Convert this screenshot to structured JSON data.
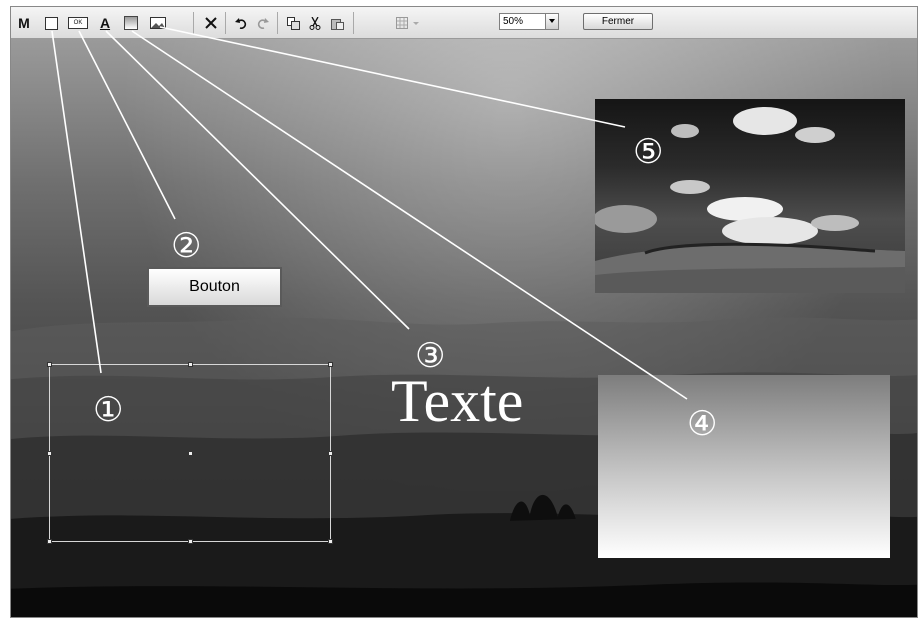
{
  "toolbar": {
    "tools": [
      {
        "name": "text-tool",
        "glyph": "M"
      },
      {
        "name": "frame-tool",
        "glyph": ""
      },
      {
        "name": "button-tool",
        "glyph": "OK"
      },
      {
        "name": "font-tool",
        "glyph": "A"
      },
      {
        "name": "gradient-tool",
        "glyph": ""
      },
      {
        "name": "image-tool",
        "glyph": ""
      }
    ],
    "zoom_value": "50%",
    "close_label": "Fermer"
  },
  "canvas": {
    "button_label": "Bouton",
    "text_label": "Texte"
  },
  "callouts": [
    "①",
    "②",
    "③",
    "④",
    "⑤"
  ]
}
